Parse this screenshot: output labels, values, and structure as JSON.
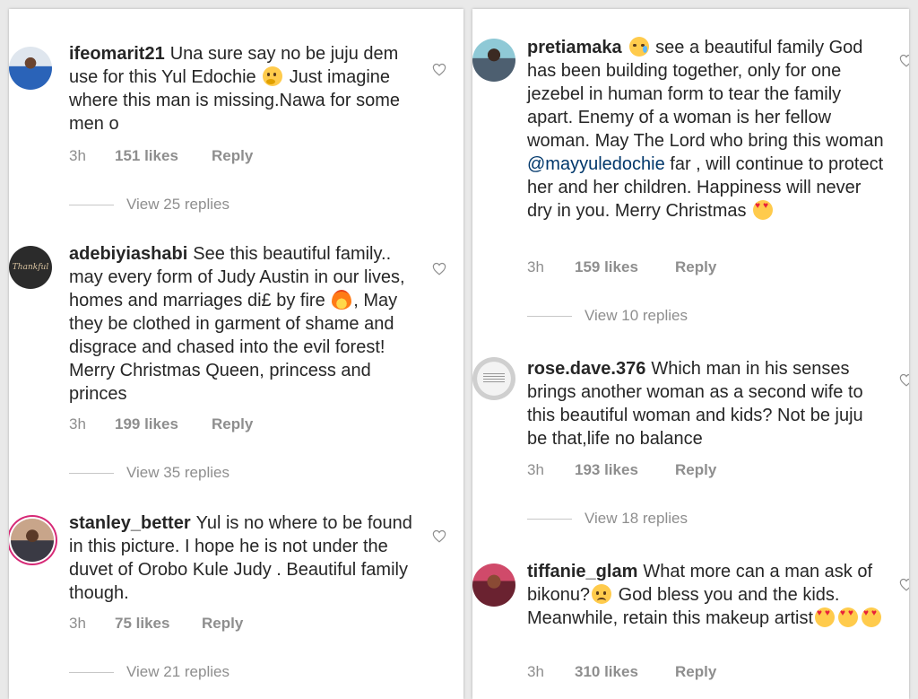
{
  "left_column": [
    {
      "username": "ifeomarit21",
      "text_parts": [
        {
          "type": "text",
          "value": "Una sure say no be juju dem use for this Yul Edochie "
        },
        {
          "type": "emoji",
          "name": "thinking-face"
        },
        {
          "type": "text",
          "value": " Just imagine where this man is missing.Nawa for some men o"
        }
      ],
      "time": "3h",
      "likes": "151 likes",
      "reply_label": "Reply",
      "view_replies": "View 25 replies"
    },
    {
      "username": "adebiyiashabi",
      "avatar_text": "Thankful",
      "text_parts": [
        {
          "type": "text",
          "value": "See this beautiful family.. may every form of Judy Austin in our lives, homes and marriages di£ by fire "
        },
        {
          "type": "emoji",
          "name": "fire"
        },
        {
          "type": "text",
          "value": ", May they be clothed in garment of shame and disgrace and chased into the evil forest! Merry Christmas Queen, princess and princes"
        }
      ],
      "time": "3h",
      "likes": "199 likes",
      "reply_label": "Reply",
      "view_replies": "View 35 replies"
    },
    {
      "username": "stanley_better",
      "text_parts": [
        {
          "type": "text",
          "value": "Yul is no where to be found in this picture. I hope he is not under the duvet of Orobo Kule Judy . Beautiful family though."
        }
      ],
      "time": "3h",
      "likes": "75 likes",
      "reply_label": "Reply",
      "view_replies": "View 21 replies"
    }
  ],
  "right_column": [
    {
      "username": "pretiamaka",
      "text_parts": [
        {
          "type": "emoji",
          "name": "crying-face"
        },
        {
          "type": "text",
          "value": " see a beautiful family God has been building together, only for one jezebel in human form to tear the family apart. Enemy of a woman is her fellow woman. May The Lord who bring this woman "
        },
        {
          "type": "mention",
          "value": "@mayyuledochie"
        },
        {
          "type": "text",
          "value": " far , will continue to protect her and her children. Happiness will never dry in you. Merry Christmas "
        },
        {
          "type": "emoji",
          "name": "heart-eyes"
        }
      ],
      "time": "3h",
      "likes": "159 likes",
      "reply_label": "Reply",
      "view_replies": "View 10 replies"
    },
    {
      "username": "rose.dave.376",
      "text_parts": [
        {
          "type": "text",
          "value": "Which man in his senses brings another woman as a second wife to this beautiful woman and kids? Not be juju be that,life no balance"
        }
      ],
      "time": "3h",
      "likes": "193 likes",
      "reply_label": "Reply",
      "view_replies": "View 18 replies"
    },
    {
      "username": "tiffanie_glam",
      "text_parts": [
        {
          "type": "text",
          "value": "What more can a man ask of bikonu?"
        },
        {
          "type": "emoji",
          "name": "sad-face"
        },
        {
          "type": "text",
          "value": " God bless you and the kids. Meanwhile, retain this makeup artist"
        },
        {
          "type": "emoji",
          "name": "heart-eyes"
        },
        {
          "type": "emoji",
          "name": "heart-eyes"
        },
        {
          "type": "emoji",
          "name": "heart-eyes"
        }
      ],
      "time": "3h",
      "likes": "310 likes",
      "reply_label": "Reply"
    }
  ],
  "colors": {
    "text": "#262626",
    "meta": "#8e8e8e",
    "mention": "#00376b",
    "story_ring": "#d62976"
  }
}
